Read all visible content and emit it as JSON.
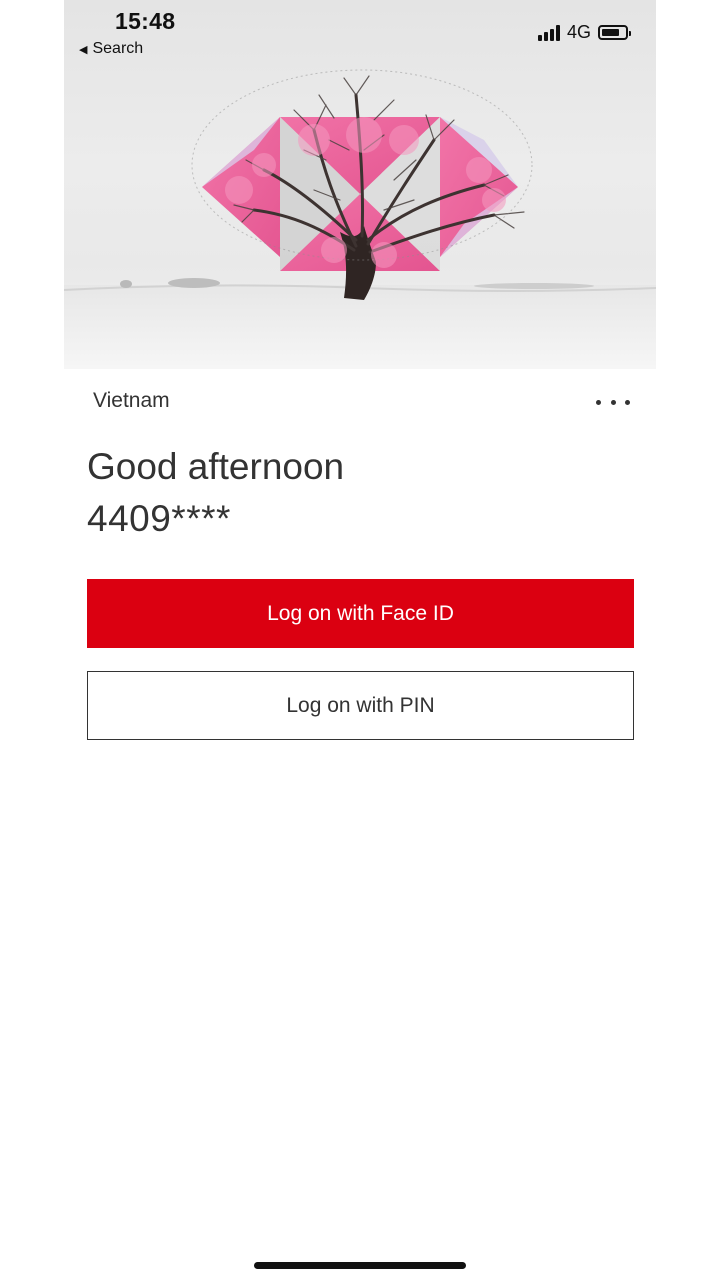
{
  "status_bar": {
    "time": "15:48",
    "back_label": "Search",
    "network": "4G",
    "battery_level": 0.7
  },
  "hero": {
    "description_icon": "logo-hexagon-tree-icon"
  },
  "login": {
    "region": "Vietnam",
    "greeting": "Good afternoon",
    "account_masked": "4409****",
    "faceid_label": "Log on with Face ID",
    "pin_label": "Log on with PIN"
  },
  "colors": {
    "brand_red": "#db0011",
    "text": "#333333",
    "petals": "#ea5c97"
  }
}
